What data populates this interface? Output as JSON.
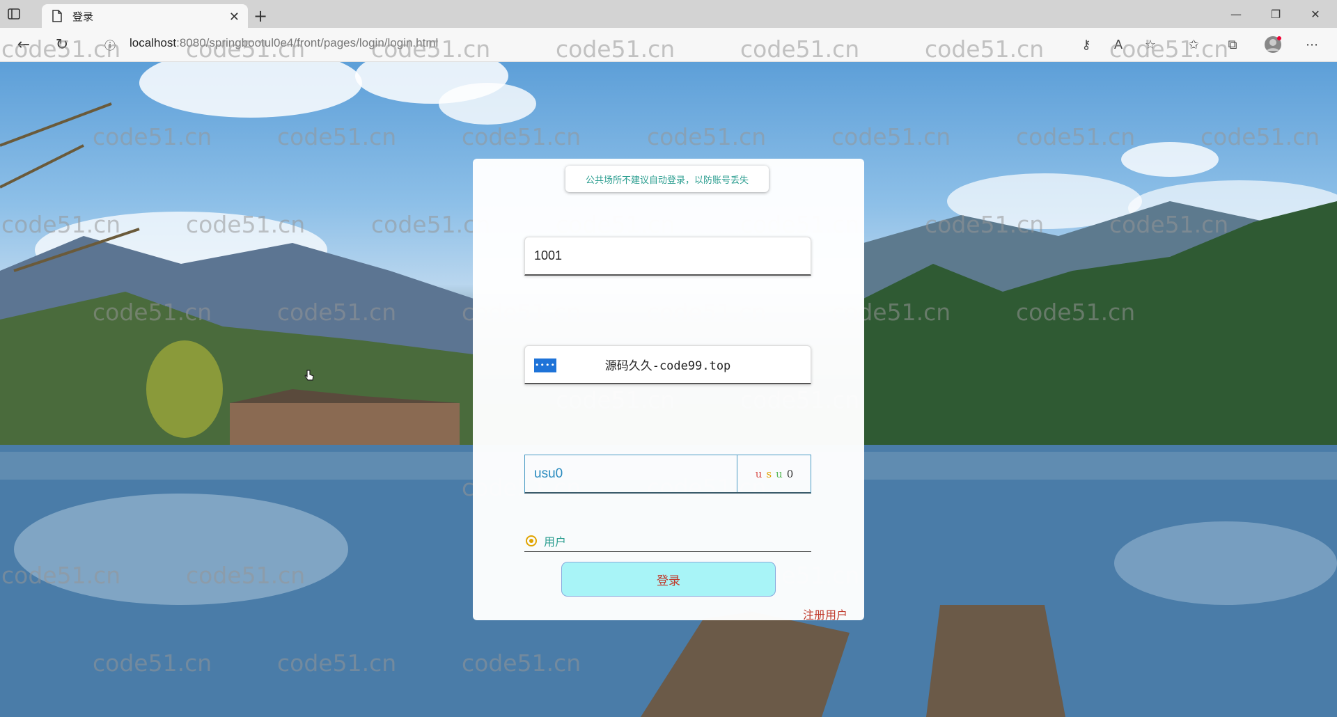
{
  "browser": {
    "tab_title": "登录",
    "url_host": "localhost",
    "url_rest": ":8080/springbootul0e4/front/pages/login/login.html"
  },
  "watermark": "code51.cn",
  "login": {
    "tip": "公共场所不建议自动登录，以防账号丢失",
    "username_value": "1001",
    "password_mask": "••••",
    "password_display": "源码久久-code99.top",
    "captcha_value": "usu0",
    "captcha_chars": [
      "u",
      "s",
      "u",
      "0"
    ],
    "captcha_colors": [
      "#d9534f",
      "#e0a300",
      "#5cb85c",
      "#333333"
    ],
    "role_label": "用户",
    "login_button": "登录",
    "register_link": "注册用户"
  }
}
